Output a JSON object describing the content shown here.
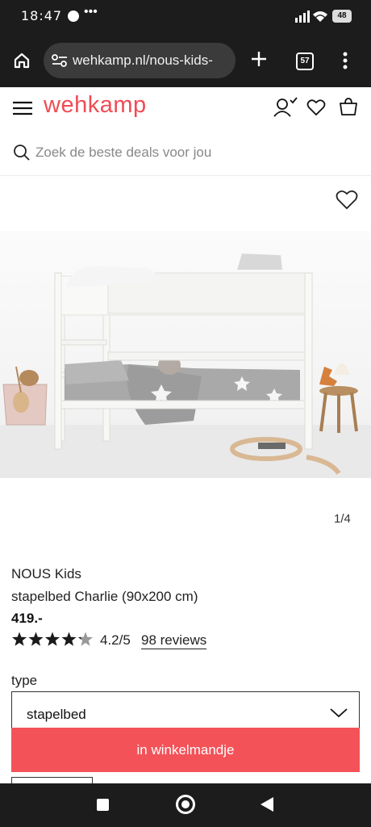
{
  "status_bar": {
    "time": "18:47",
    "dots": "•••",
    "battery": "48"
  },
  "browser": {
    "url": "wehkamp.nl/nous-kids-",
    "tab_count": "57"
  },
  "header": {
    "logo": "wehkamp"
  },
  "search": {
    "placeholder": "Zoek de beste deals voor jou"
  },
  "gallery": {
    "counter": "1/4"
  },
  "product": {
    "brand": "NOUS Kids",
    "name": "stapelbed Charlie (90x200 cm)",
    "price": "419.-",
    "rating_score": "4.2/5",
    "rating_value": 4.2,
    "reviews": "98 reviews"
  },
  "type_select": {
    "label": "type",
    "value": "stapelbed"
  },
  "cart_button": {
    "label": "in winkelmandje"
  },
  "colors": {
    "brand": "#f04b54",
    "cart": "#f35258",
    "system_bar": "#1c1c1c"
  }
}
